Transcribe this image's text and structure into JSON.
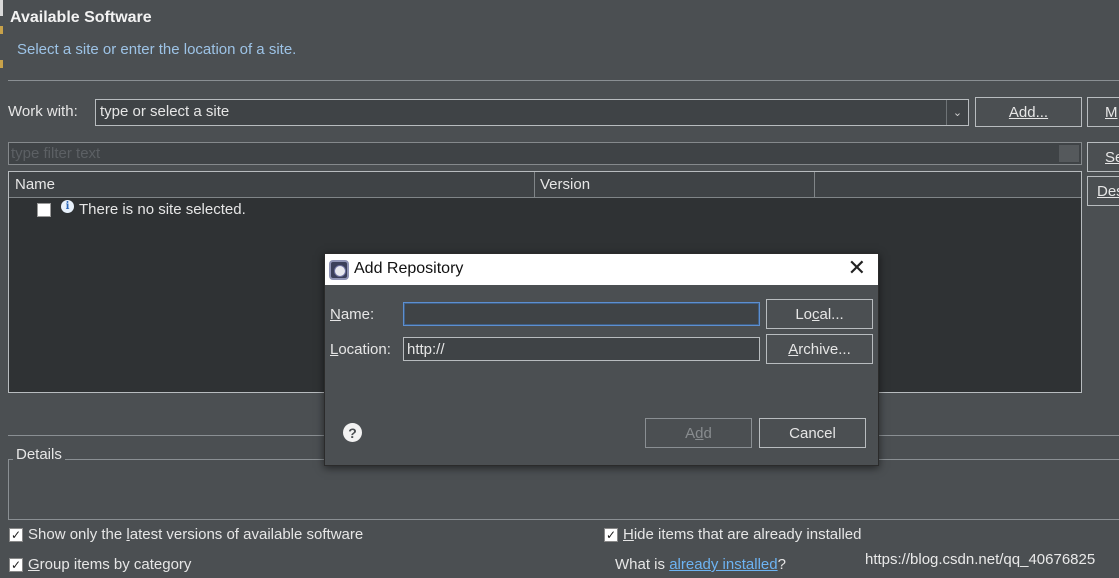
{
  "header": {
    "title": "Available Software",
    "subtitle": "Select a site or enter the location of a site."
  },
  "work_with": {
    "label": "Work with:",
    "combo_value": "type or select a site",
    "add_button": "Add...",
    "manage_button": "M"
  },
  "filter": {
    "placeholder": "type filter text"
  },
  "side_buttons": {
    "select_all": "Se",
    "deselect_all": "Des"
  },
  "table": {
    "columns": [
      "Name",
      "Version"
    ],
    "empty_row": {
      "checked": false,
      "text": "There is no site selected."
    }
  },
  "details": {
    "label": "Details"
  },
  "options": {
    "show_latest": {
      "checked": true,
      "pre": "Show only the ",
      "accel": "l",
      "post": "atest versions of available software"
    },
    "group_by_category": {
      "checked": true,
      "pre": "",
      "accel": "G",
      "post": "roup items by category"
    },
    "hide_installed": {
      "checked": true,
      "pre": "",
      "accel": "H",
      "post": "ide items that are already installed"
    },
    "what_installed": {
      "pre": "What is ",
      "link": "already installed",
      "post": "?"
    }
  },
  "watermark": "https://blog.csdn.net/qq_40676825",
  "dialog": {
    "title": "Add Repository",
    "name_label_accel": "N",
    "name_label_rest": "ame:",
    "name_value": "",
    "location_label_accel": "L",
    "location_label_rest": "ocation:",
    "location_value": "http://",
    "local_button_pre": "Lo",
    "local_button_accel": "c",
    "local_button_post": "al...",
    "archive_button_accel": "A",
    "archive_button_post": "rchive...",
    "add_button_pre": "A",
    "add_button_accel": "d",
    "add_button_post": "d",
    "cancel_button": "Cancel"
  },
  "icons": {
    "combo_arrow": "chevron-down-icon",
    "info": "info-icon",
    "help": "help-icon",
    "close": "close-icon",
    "dialog": "eclipse-icon"
  }
}
